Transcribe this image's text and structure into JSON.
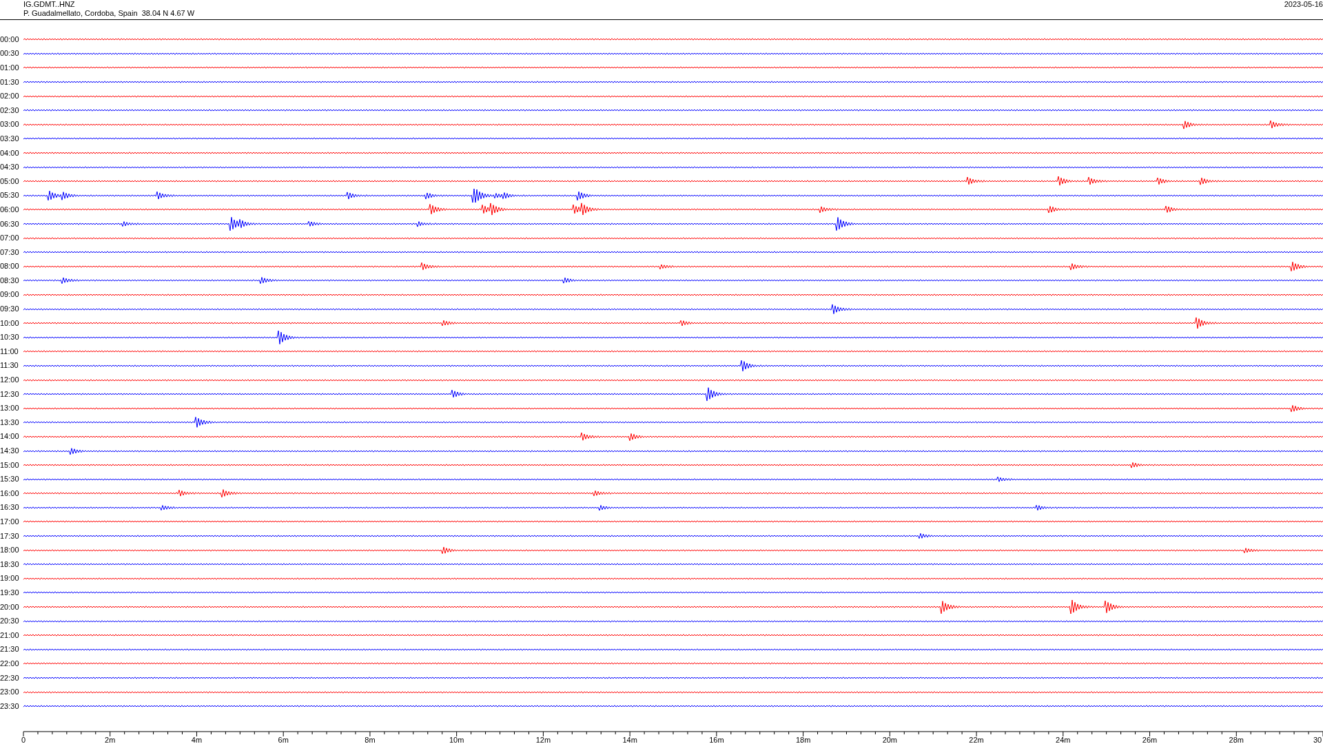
{
  "header": {
    "station": "IG.GDMT..HNZ",
    "location": "P. Guadalmellato, Cordoba, Spain  38.04 N 4.67 W",
    "date": "2023-05-16"
  },
  "rows": [
    {
      "time": "00:00",
      "color": "#ff0000"
    },
    {
      "time": "00:30",
      "color": "#0000ff"
    },
    {
      "time": "01:00",
      "color": "#ff0000"
    },
    {
      "time": "01:30",
      "color": "#0000ff"
    },
    {
      "time": "02:00",
      "color": "#ff0000"
    },
    {
      "time": "02:30",
      "color": "#0000ff"
    },
    {
      "time": "03:00",
      "color": "#ff0000"
    },
    {
      "time": "03:30",
      "color": "#0000ff"
    },
    {
      "time": "04:00",
      "color": "#ff0000"
    },
    {
      "time": "04:30",
      "color": "#0000ff"
    },
    {
      "time": "05:00",
      "color": "#ff0000"
    },
    {
      "time": "05:30",
      "color": "#0000ff"
    },
    {
      "time": "06:00",
      "color": "#ff0000"
    },
    {
      "time": "06:30",
      "color": "#0000ff"
    },
    {
      "time": "07:00",
      "color": "#ff0000"
    },
    {
      "time": "07:30",
      "color": "#0000ff"
    },
    {
      "time": "08:00",
      "color": "#ff0000"
    },
    {
      "time": "08:30",
      "color": "#0000ff"
    },
    {
      "time": "09:00",
      "color": "#ff0000"
    },
    {
      "time": "09:30",
      "color": "#0000ff"
    },
    {
      "time": "10:00",
      "color": "#ff0000"
    },
    {
      "time": "10:30",
      "color": "#0000ff"
    },
    {
      "time": "11:00",
      "color": "#ff0000"
    },
    {
      "time": "11:30",
      "color": "#0000ff"
    },
    {
      "time": "12:00",
      "color": "#ff0000"
    },
    {
      "time": "12:30",
      "color": "#0000ff"
    },
    {
      "time": "13:00",
      "color": "#ff0000"
    },
    {
      "time": "13:30",
      "color": "#0000ff"
    },
    {
      "time": "14:00",
      "color": "#ff0000"
    },
    {
      "time": "14:30",
      "color": "#0000ff"
    },
    {
      "time": "15:00",
      "color": "#ff0000"
    },
    {
      "time": "15:30",
      "color": "#0000ff"
    },
    {
      "time": "16:00",
      "color": "#ff0000"
    },
    {
      "time": "16:30",
      "color": "#0000ff"
    },
    {
      "time": "17:00",
      "color": "#ff0000"
    },
    {
      "time": "17:30",
      "color": "#0000ff"
    },
    {
      "time": "18:00",
      "color": "#ff0000"
    },
    {
      "time": "18:30",
      "color": "#0000ff"
    },
    {
      "time": "19:00",
      "color": "#ff0000"
    },
    {
      "time": "19:30",
      "color": "#0000ff"
    },
    {
      "time": "20:00",
      "color": "#ff0000"
    },
    {
      "time": "20:30",
      "color": "#0000ff"
    },
    {
      "time": "21:00",
      "color": "#ff0000"
    },
    {
      "time": "21:30",
      "color": "#0000ff"
    },
    {
      "time": "22:00",
      "color": "#ff0000"
    },
    {
      "time": "22:30",
      "color": "#0000ff"
    },
    {
      "time": "23:00",
      "color": "#ff0000"
    },
    {
      "time": "23:30",
      "color": "#0000ff"
    }
  ],
  "x_axis": {
    "labels": [
      "0",
      "2m",
      "4m",
      "6m",
      "8m",
      "10m",
      "12m",
      "14m",
      "16m",
      "18m",
      "20m",
      "22m",
      "24m",
      "26m",
      "28m",
      "30"
    ]
  }
}
